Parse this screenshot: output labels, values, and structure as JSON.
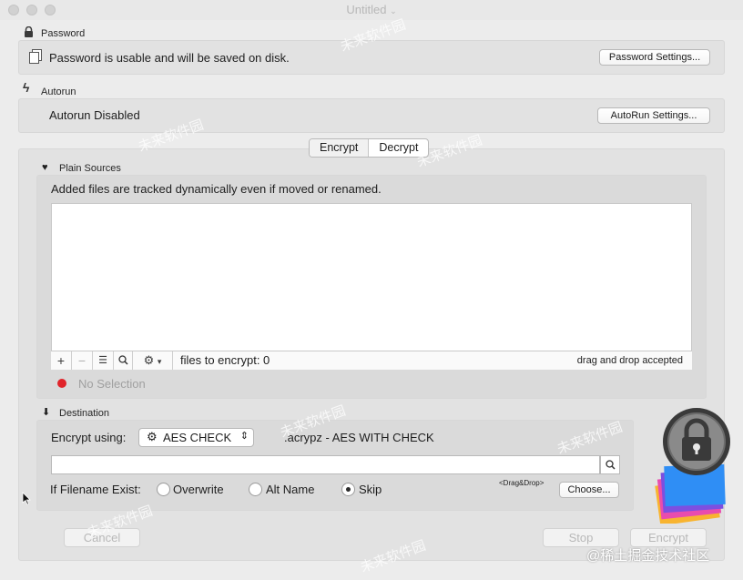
{
  "window": {
    "title": "Untitled"
  },
  "password": {
    "section_label": "Password",
    "status": "Password is usable and will be saved on disk.",
    "settings_button": "Password Settings..."
  },
  "autorun": {
    "section_label": "Autorun",
    "status": "Autorun Disabled",
    "settings_button": "AutoRun Settings..."
  },
  "mode_tabs": {
    "encrypt": "Encrypt",
    "decrypt": "Decrypt",
    "selected": "Encrypt"
  },
  "plain_sources": {
    "section_label": "Plain Sources",
    "description": "Added files are tracked dynamically  even if moved or renamed.",
    "files_count_text": "files to encrypt: 0",
    "drag_hint": "drag and drop accepted",
    "selection_status": "No Selection"
  },
  "destination": {
    "section_label": "Destination",
    "encrypt_using_label": "Encrypt using:",
    "method_value": "AES CHECK",
    "method_description": ".acrypz - AES WITH CHECK",
    "path_value": "",
    "if_exists_label": "If Filename Exist:",
    "options": [
      "Overwrite",
      "Alt Name",
      "Skip"
    ],
    "selected_option": "Skip",
    "drag_drop_label": "<Drag&Drop>",
    "choose_button": "Choose..."
  },
  "footer": {
    "cancel": "Cancel",
    "stop": "Stop",
    "encrypt": "Encrypt"
  },
  "watermark": {
    "corner_text": "@稀土掘金技术社区",
    "site_text": "未来软件园"
  },
  "colors": {
    "status_dot": "#e0242a",
    "lock_dark": "#3a3a3a"
  }
}
